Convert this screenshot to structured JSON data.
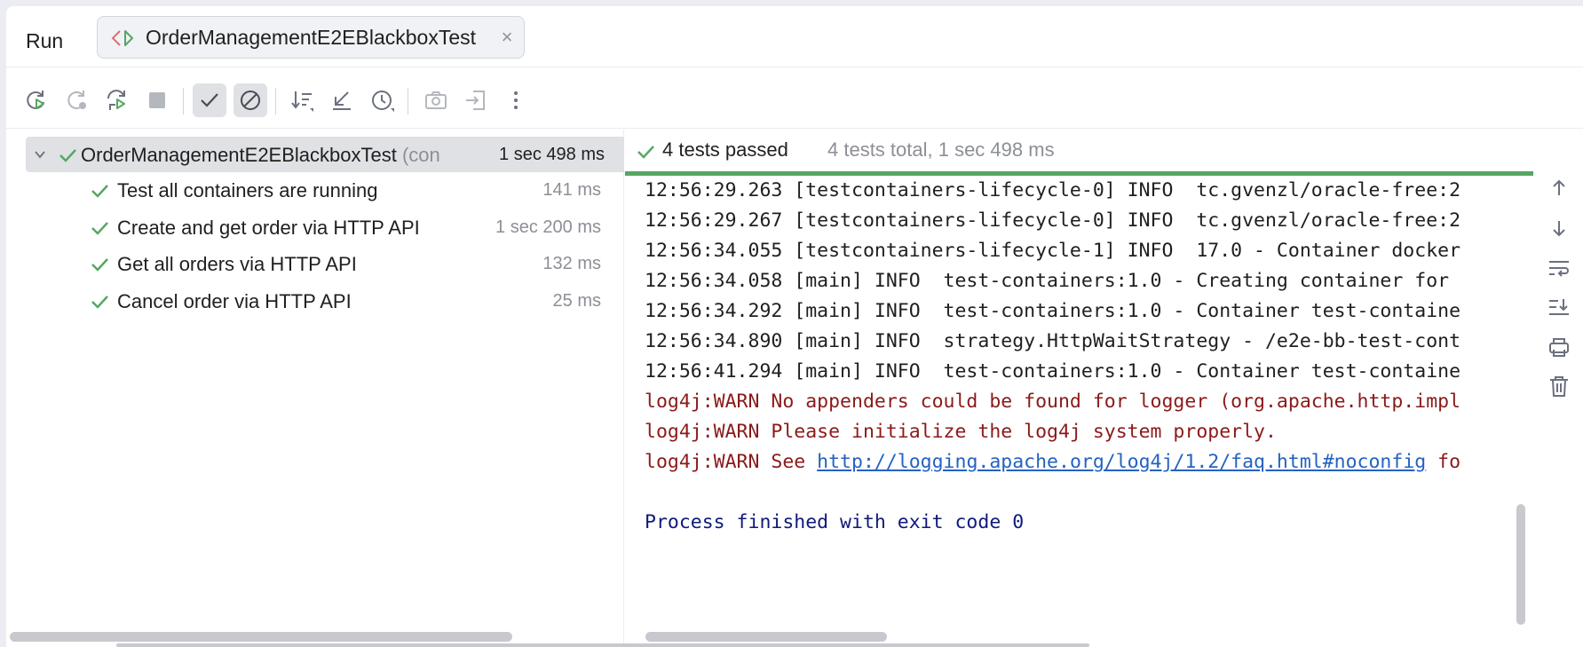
{
  "header": {
    "run_label": "Run",
    "tab_label": "OrderManagementE2EBlackboxTest"
  },
  "toolbar": {
    "buttons": [
      "rerun-icon",
      "rerun-failed-icon",
      "toggle-auto-test-icon",
      "stop-icon",
      "show-passed-icon",
      "show-ignored-icon",
      "sort-icon",
      "collapse-icon",
      "test-history-icon",
      "screenshot-icon",
      "export-icon",
      "more-icon"
    ]
  },
  "tree": {
    "root": {
      "name": "OrderManagementE2EBlackboxTest",
      "suffix": "(con",
      "duration": "1 sec 498 ms"
    },
    "tests": [
      {
        "name": "Test all containers are running",
        "duration": "141 ms"
      },
      {
        "name": "Create and get order via HTTP API",
        "duration": "1 sec 200 ms"
      },
      {
        "name": "Get all orders via HTTP API",
        "duration": "132 ms"
      },
      {
        "name": "Cancel order via HTTP API",
        "duration": "25 ms"
      }
    ]
  },
  "console": {
    "status_passed": "4 tests passed",
    "status_total": "4 tests total, 1 sec 498 ms",
    "lines": [
      "12:56:29.263 [testcontainers-lifecycle-0] INFO  tc.gvenzl/oracle-free:2",
      "12:56:29.267 [testcontainers-lifecycle-0] INFO  tc.gvenzl/oracle-free:2",
      "12:56:34.055 [testcontainers-lifecycle-1] INFO  17.0 - Container docker",
      "12:56:34.058 [main] INFO  test-containers:1.0 - Creating container for",
      "12:56:34.292 [main] INFO  test-containers:1.0 - Container test-containe",
      "12:56:34.890 [main] INFO  strategy.HttpWaitStrategy - /e2e-bb-test-cont",
      "12:56:41.294 [main] INFO  test-containers:1.0 - Container test-containe"
    ],
    "warn_lines": [
      "log4j:WARN No appenders could be found for logger (org.apache.http.impl",
      "log4j:WARN Please initialize the log4j system properly."
    ],
    "warn_see_prefix": "log4j:WARN See ",
    "warn_see_link": "http://logging.apache.org/log4j/1.2/faq.html#noconfig",
    "warn_see_suffix": " fo",
    "finish_line": "Process finished with exit code 0"
  },
  "colors": {
    "pass_green": "#55a762",
    "warn_red": "#8b1a1a",
    "finish_blue": "#0f1a7a",
    "link_blue": "#2462c2"
  }
}
